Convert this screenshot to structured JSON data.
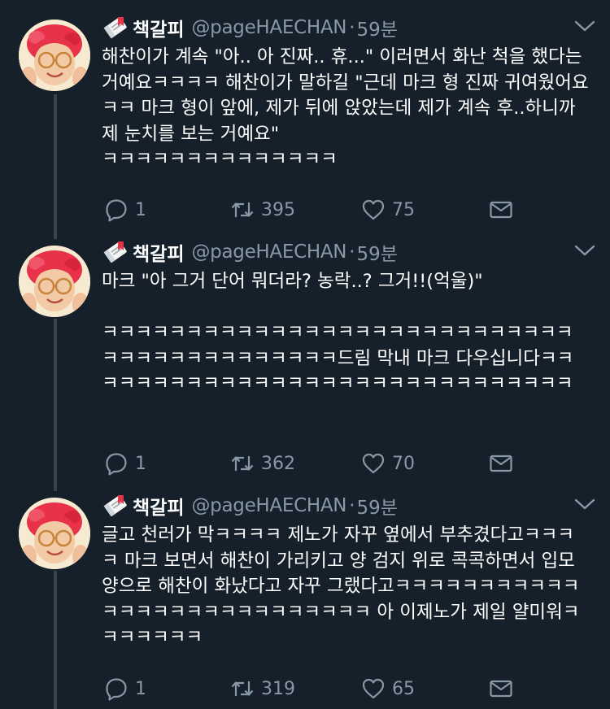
{
  "tweets": [
    {
      "display_name": "책갈피",
      "handle": "@pageHAECHAN",
      "separator": "·",
      "time": "59분",
      "text": "해찬이가 계속 \"아.. 아 진짜.. 휴...\" 이러면서 화난 척을 했다는 거예요ㅋㅋㅋㅋ 해찬이가 말하길 \"근데 마크 형 진짜 귀여웠어요ㅋㅋ 마크 형이 앞에, 제가 뒤에 앉았는데 제가 계속 후..하니까 제 눈치를 보는 거예요\"\nㅋㅋㅋㅋㅋㅋㅋㅋㅋㅋㅋㅋㅋㅋ",
      "replies": "1",
      "retweets": "395",
      "likes": "75"
    },
    {
      "display_name": "책갈피",
      "handle": "@pageHAECHAN",
      "separator": "·",
      "time": "59분",
      "text": "마크 \"아 그거 단어 뭐더라? 농락..? 그거!!(억울)\"\n\nㅋㅋㅋㅋㅋㅋㅋㅋㅋㅋㅋㅋㅋㅋㅋㅋㅋㅋㅋㅋㅋㅋㅋㅋㅋㅋㅋㅋㅋㅋㅋㅋㅋㅋㅋㅋㅋㅋㅋㅋㅋㅋ드림 막내 마크 다우십니다ㅋㅋㅋㅋㅋㅋㅋㅋㅋㅋㅋㅋㅋㅋㅋㅋㅋㅋㅋㅋㅋㅋㅋㅋㅋㅋㅋㅋㅋㅋ",
      "replies": "1",
      "retweets": "362",
      "likes": "70"
    },
    {
      "display_name": "책갈피",
      "handle": "@pageHAECHAN",
      "separator": "·",
      "time": "59분",
      "text": "글고 천러가 막ㅋㅋㅋㅋ 제노가 자꾸 옆에서 부추겼다고ㅋㅋㅋㅋ 마크 보면서 해찬이 가리키고 양 검지 위로 콕콕하면서 입모양으로 해찬이 화났다고 자꾸 그랬다고ㅋㅋㅋㅋㅋㅋㅋㅋㅋㅋㅋㅋㅋㅋㅋㅋㅋㅋㅋㅋㅋㅋㅋㅋㅋㅋㅋ 아 이제노가 제일 얄미워ㅋㅋㅋㅋㅋㅋㅋ",
      "replies": "1",
      "retweets": "319",
      "likes": "65"
    }
  ],
  "colors": {
    "background": "#15202b",
    "secondary_text": "#8899a6",
    "thread_line": "#37444f"
  },
  "icons": {
    "name_emoji": "bookmark-emoji-icon",
    "caret": "chevron-down-icon",
    "reply": "reply-icon",
    "retweet": "retweet-icon",
    "like": "heart-icon",
    "dm": "envelope-icon"
  }
}
